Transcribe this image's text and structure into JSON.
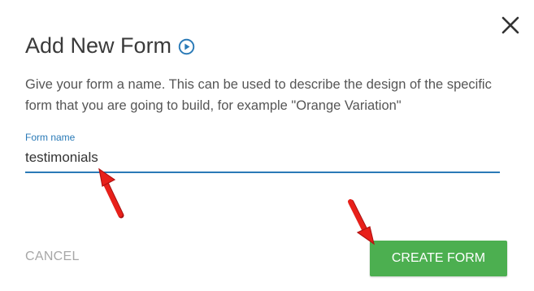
{
  "dialog": {
    "title": "Add New Form",
    "description": "Give your form a name. This can be used to describe the design of the specific form that you are going to build, for example \"Orange Variation\"",
    "field": {
      "label": "Form name",
      "value": "testimonials"
    },
    "cancel_label": "CANCEL",
    "create_label": "CREATE FORM"
  },
  "icons": {
    "title_icon": "play-circle-icon",
    "close_icon": "close-icon",
    "annotation": "red-arrow-icon"
  },
  "colors": {
    "accent": "#2a7ab7",
    "create_button": "#4caf50",
    "annotation_arrow": "#e8201a"
  }
}
